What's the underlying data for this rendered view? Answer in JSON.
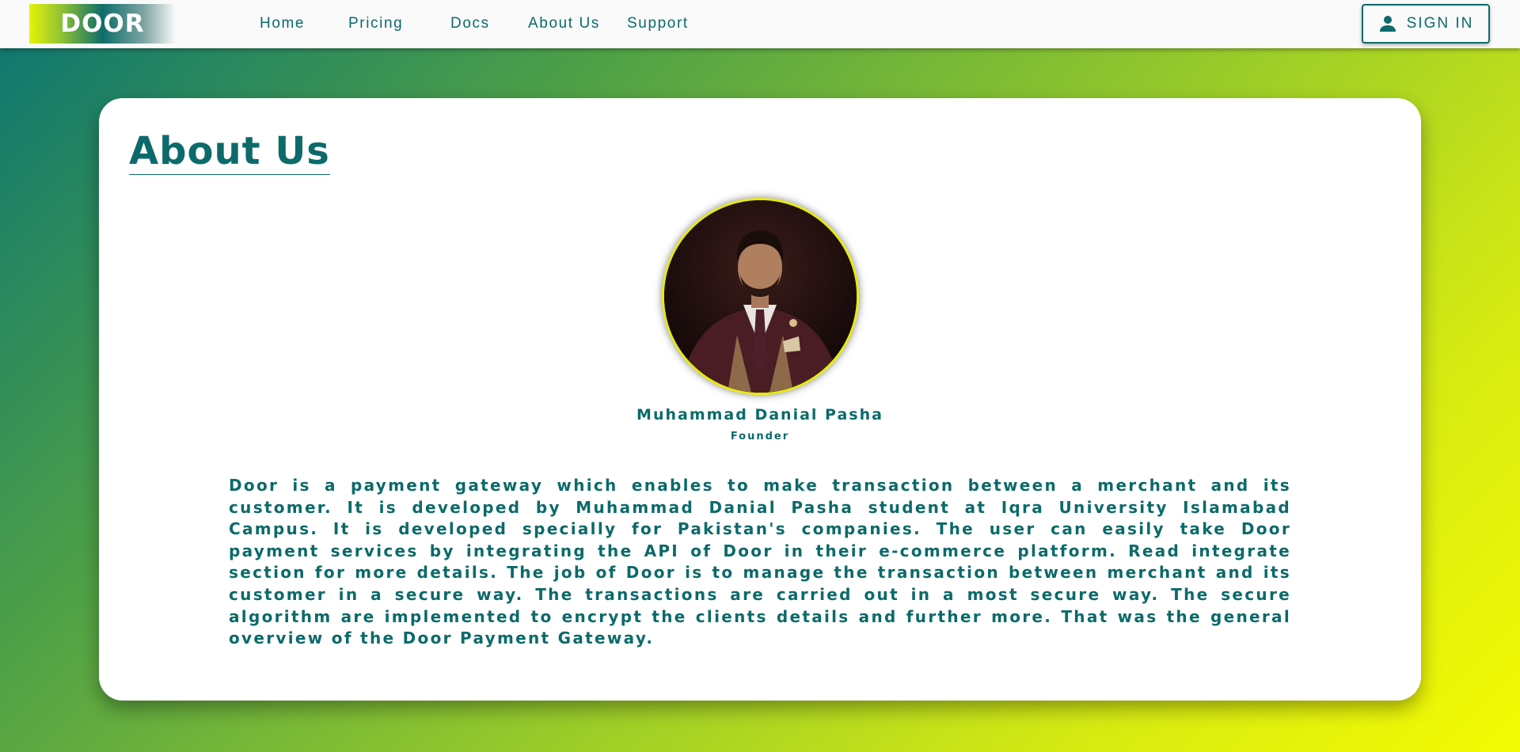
{
  "header": {
    "logo_text": "DOOR",
    "nav": [
      {
        "label": "Home"
      },
      {
        "label": "Pricing"
      },
      {
        "label": "Docs"
      },
      {
        "label": "About Us"
      },
      {
        "label": "Support"
      }
    ],
    "sign_in_label": "SIGN IN",
    "sign_in_icon": "person-icon"
  },
  "main": {
    "title": "About Us",
    "profile": {
      "name": "Muhammad Danial Pasha",
      "role": "Founder"
    },
    "description": "Door is a payment gateway which enables to make transaction between a merchant and its customer. It is developed by Muhammad Danial Pasha student at Iqra University Islamabad Campus. It is developed specially for Pakistan's companies. The user can easily take Door payment services by integrating the API of Door in their e-commerce platform. Read integrate section for more details. The job of Door is to manage the transaction between merchant and its customer in a secure way. The transactions are carried out in a most secure way. The secure algorithm are implemented to encrypt the clients details and further more. That was the general overview of the Door Payment Gateway."
  },
  "colors": {
    "primary": "#0c6a6a",
    "accent": "#f4fb02",
    "card_bg": "#ffffff"
  }
}
